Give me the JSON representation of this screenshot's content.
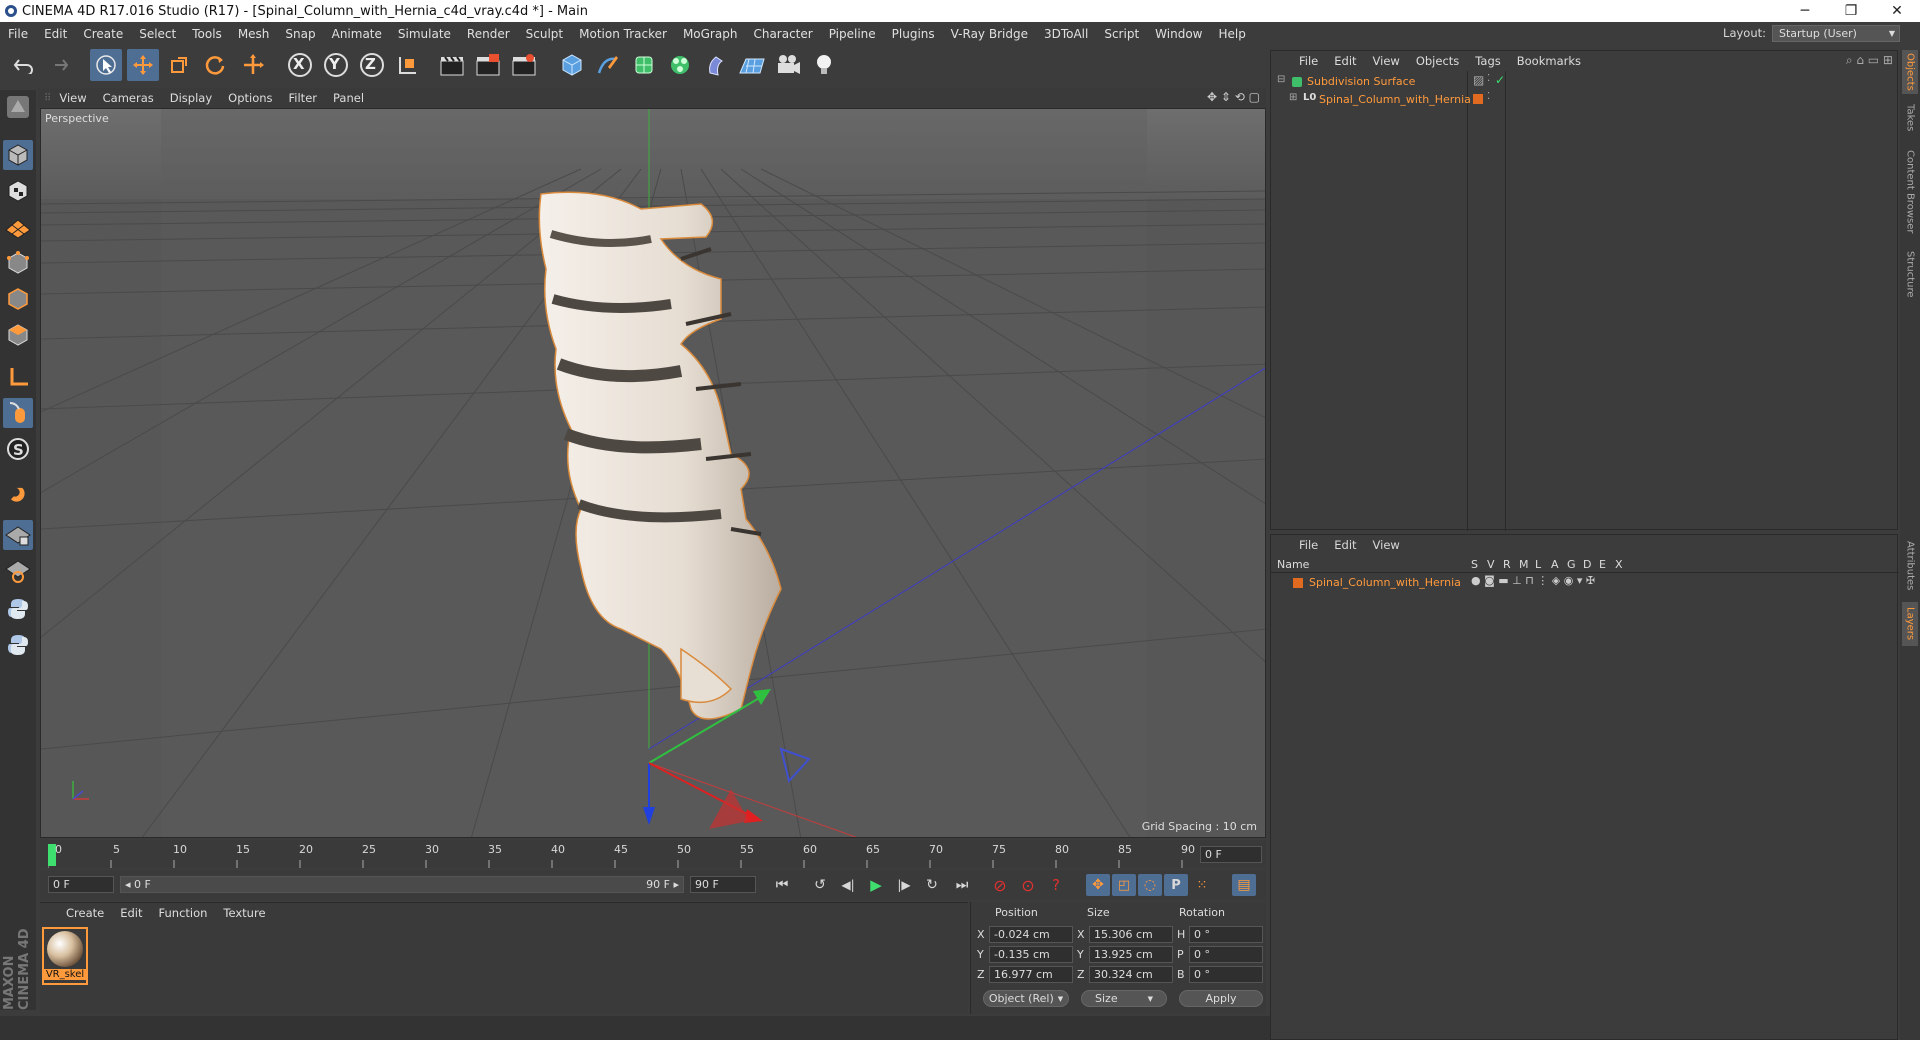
{
  "window": {
    "title": "CINEMA 4D R17.016 Studio (R17) - [Spinal_Column_with_Hernia_c4d_vray.c4d *] - Main",
    "minimize": "─",
    "restore": "❐",
    "close": "✕"
  },
  "menubar": {
    "items": [
      "File",
      "Edit",
      "Create",
      "Select",
      "Tools",
      "Mesh",
      "Snap",
      "Animate",
      "Simulate",
      "Render",
      "Sculpt",
      "Motion Tracker",
      "MoGraph",
      "Character",
      "Pipeline",
      "Plugins",
      "V-Ray Bridge",
      "3DToAll",
      "Script",
      "Window",
      "Help"
    ],
    "layout_label": "Layout:",
    "layout_value": "Startup (User)"
  },
  "toolbar": {
    "axis_x": "X",
    "axis_y": "Y",
    "axis_z": "Z"
  },
  "viewport": {
    "menu": [
      "View",
      "Cameras",
      "Display",
      "Options",
      "Filter",
      "Panel"
    ],
    "label": "Perspective",
    "grid_spacing": "Grid Spacing : 10 cm"
  },
  "timeline": {
    "ticks": [
      "0",
      "5",
      "10",
      "15",
      "20",
      "25",
      "30",
      "35",
      "40",
      "45",
      "50",
      "55",
      "60",
      "65",
      "70",
      "75",
      "80",
      "85",
      "90"
    ],
    "current_frame": "0 F",
    "start_field": "0 F",
    "range_start": "◂ 0 F",
    "range_end": "90 F ▸",
    "end_field": "90 F"
  },
  "materials": {
    "menu": [
      "Create",
      "Edit",
      "Function",
      "Texture"
    ],
    "items": [
      {
        "name": "VR_skel"
      }
    ]
  },
  "coordinates": {
    "headers": {
      "position": "Position",
      "size": "Size",
      "rotation": "Rotation"
    },
    "rows": [
      {
        "axis": "X",
        "pos": "-0.024 cm",
        "saxis": "X",
        "size": "15.306 cm",
        "raxis": "H",
        "rot": "0 °"
      },
      {
        "axis": "Y",
        "pos": "-0.135 cm",
        "saxis": "Y",
        "size": "13.925 cm",
        "raxis": "P",
        "rot": "0 °"
      },
      {
        "axis": "Z",
        "pos": "16.977 cm",
        "saxis": "Z",
        "size": "30.324 cm",
        "raxis": "B",
        "rot": "0 °"
      }
    ],
    "mode": "Object (Rel)",
    "size_mode": "Size",
    "apply": "Apply"
  },
  "objects": {
    "menu": [
      "File",
      "Edit",
      "View",
      "Objects",
      "Tags",
      "Bookmarks"
    ],
    "items": [
      {
        "name": "Subdivision Surface"
      },
      {
        "name": "Spinal_Column_with_Hernia"
      }
    ]
  },
  "layers": {
    "menu": [
      "File",
      "Edit",
      "View"
    ],
    "columns": {
      "name": "Name",
      "flags": [
        "S",
        "V",
        "R",
        "M",
        "L",
        "A",
        "G",
        "D",
        "E",
        "X"
      ]
    },
    "items": [
      {
        "name": "Spinal_Column_with_Hernia"
      }
    ]
  },
  "right_tabs": [
    "Objects",
    "Takes",
    "Content Browser",
    "Structure",
    "Attributes",
    "Layers"
  ],
  "brand": "MAXON CINEMA 4D",
  "colors": {
    "accent": "#ff9a3c",
    "selection": "#4f6e94",
    "background": "#3c3c3c",
    "viewport": "#5a5a5a"
  }
}
